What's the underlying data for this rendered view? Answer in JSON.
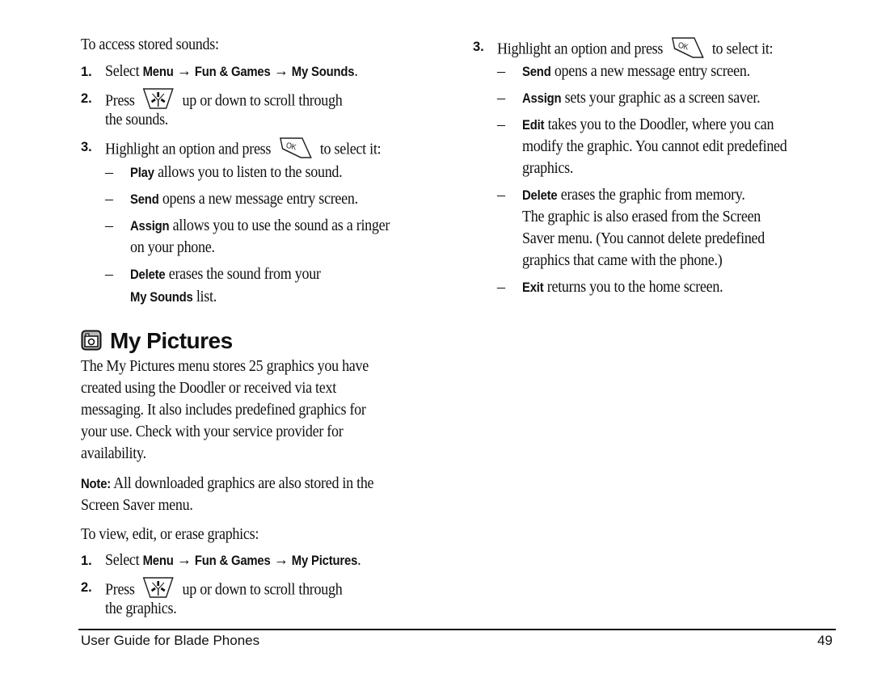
{
  "left": {
    "intro": "To access stored sounds:",
    "step1": {
      "num": "1.",
      "pre": "Select ",
      "menu": "Menu",
      "arrow1": " → ",
      "fun": "Fun & Games",
      "arrow2": " → ",
      "target": "My Sounds",
      "end": "."
    },
    "step2": {
      "num": "2.",
      "pre": "Press",
      "post": "up or down to scroll through",
      "line2": "the sounds."
    },
    "step3": {
      "num": "3.",
      "pre": "Highlight an option and press",
      "post": "to select it:"
    },
    "options": [
      {
        "bold": "Play",
        "text": " allows you to listen to the sound."
      },
      {
        "bold": "Send",
        "text": " opens a new message entry screen."
      },
      {
        "bold": "Assign",
        "text": " allows you to use the sound as a ringer",
        "line2": "on your phone."
      },
      {
        "bold": "Delete",
        "text": " erases the sound from your",
        "line2_bold": "My Sounds",
        "line2": " list."
      }
    ],
    "section_title": "My Pictures",
    "section_icon": "my-pictures-icon",
    "paragraph": [
      "The My Pictures menu stores 25 graphics you have",
      "created using the Doodler or received via text",
      "messaging. It also includes predefined graphics for",
      "your use. Check with your service provider for",
      "availability."
    ],
    "note": {
      "label": "Note:",
      "line1": "  All downloaded graphics are also stored in the",
      "line2": "Screen Saver menu."
    },
    "intro2": "To view, edit, or erase graphics:",
    "step1b": {
      "num": "1.",
      "pre": "Select ",
      "menu": "Menu",
      "arrow1": " → ",
      "fun": "Fun & Games",
      "arrow2": " → ",
      "target": "My Pictures",
      "end": "."
    },
    "step2b": {
      "num": "2.",
      "pre": "Press",
      "post": "up or down to scroll through",
      "line2": "the graphics."
    }
  },
  "right": {
    "step3": {
      "num": "3.",
      "pre": "Highlight an option and press",
      "post": "to select it:"
    },
    "options": [
      {
        "bold": "Send",
        "text": " opens a new message entry screen."
      },
      {
        "bold": "Assign",
        "text": " sets your graphic as a screen saver."
      },
      {
        "bold": "Edit",
        "text": " takes you to the Doodler, where you can",
        "more": [
          "modify the graphic. You cannot edit predefined",
          "graphics."
        ]
      },
      {
        "bold": "Delete",
        "text": " erases the graphic from memory.",
        "more": [
          "The graphic is also erased from the Screen",
          "Saver menu. (You cannot delete predefined",
          "graphics that came with the phone.)"
        ]
      },
      {
        "bold": "Exit",
        "text": " returns you to the home screen."
      }
    ]
  },
  "icons": {
    "nav": "navigation-key-icon",
    "ok": "ok-key-icon"
  },
  "dash": "–",
  "footer": {
    "title": "User Guide for Blade Phones",
    "page": "49"
  }
}
